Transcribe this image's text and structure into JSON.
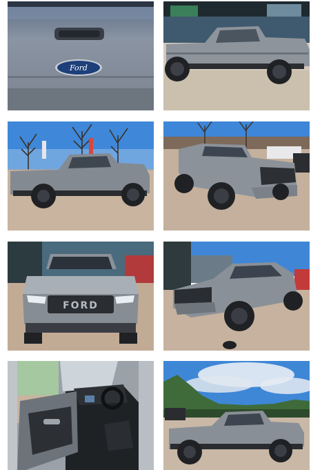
{
  "gallery": {
    "tiles": [
      {
        "view": "tailgate-closeup",
        "badge_text": "Ford"
      },
      {
        "view": "side-profile-dealer-lot"
      },
      {
        "view": "side-profile-trees"
      },
      {
        "view": "front-three-quarter-left"
      },
      {
        "view": "front-head-on",
        "grille_text": "FORD"
      },
      {
        "view": "front-three-quarter-right"
      },
      {
        "view": "interior-open-door"
      },
      {
        "view": "side-profile-sky"
      }
    ]
  },
  "colors": {
    "paint": "#8b9199",
    "paint_light": "#aeb4bb",
    "paving": "#c9b6a3",
    "sky": "#4d8fd8",
    "tire": "#1f2124"
  }
}
